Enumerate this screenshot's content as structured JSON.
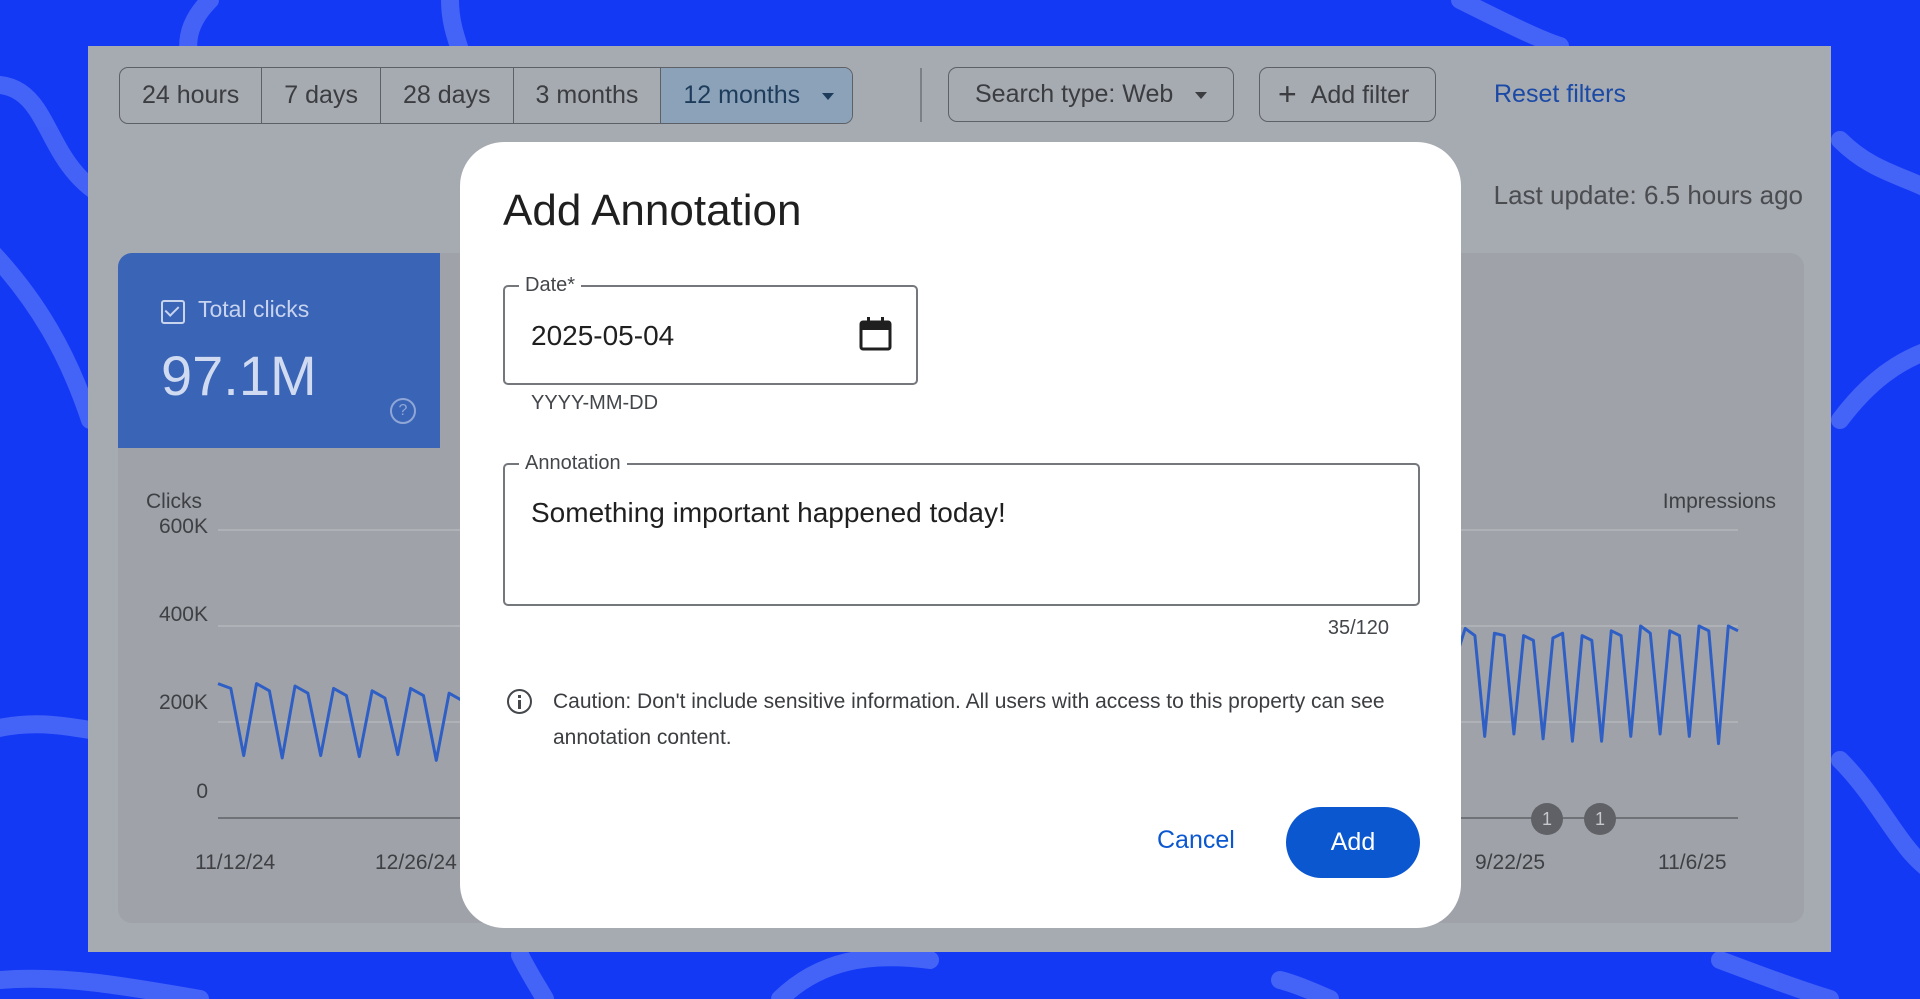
{
  "toolbar": {
    "ranges": [
      "24 hours",
      "7 days",
      "28 days",
      "3 months",
      "12 months"
    ],
    "active_range": "12 months",
    "search_type": "Search type: Web",
    "add_filter": "Add filter",
    "reset_filters": "Reset filters",
    "last_update": "Last update: 6.5 hours ago"
  },
  "metric": {
    "label": "Total clicks",
    "value": "97.1M",
    "help_icon": "help-circle-icon"
  },
  "chart_data": {
    "type": "line",
    "left_axis_label": "Clicks",
    "right_axis_label": "Impressions",
    "y_ticks": [
      "600K",
      "400K",
      "200K",
      "0"
    ],
    "ylim": [
      0,
      600000
    ],
    "x_ticks_visible": [
      "11/12/24",
      "12/26/24",
      "9/22/25",
      "11/6/25"
    ],
    "annotation_markers": [
      "1",
      "1"
    ],
    "series": [
      {
        "name": "Clicks",
        "color": "#2f5fc4",
        "segments": [
          {
            "x_range": [
              0,
              0.245
            ],
            "values": [
              280000,
              270000,
              130000,
              280000,
              265000,
              125000,
              275000,
              260000,
              130000,
              270000,
              255000,
              128000,
              265000,
              250000,
              132000,
              270000,
              255000,
              120000,
              260000,
              245000,
              115000,
              180000,
              140000,
              160000,
              110000,
              165000,
              120000,
              150000,
              110000,
              170000
            ]
          },
          {
            "x_range": [
              0.75,
              1.0
            ],
            "values": [
              250000,
              140000,
              260000,
              150000,
              270000,
              250000,
              140000,
              290000,
              300000,
              150000,
              330000,
              395000,
              380000,
              170000,
              385000,
              380000,
              175000,
              380000,
              370000,
              165000,
              375000,
              385000,
              160000,
              380000,
              370000,
              160000,
              390000,
              380000,
              170000,
              400000,
              385000,
              175000,
              390000,
              380000,
              170000,
              400000,
              390000,
              155000,
              400000,
              390000
            ]
          }
        ]
      }
    ]
  },
  "dialog": {
    "title": "Add Annotation",
    "date_label": "Date*",
    "date_value": "2025-05-04",
    "date_helper": "YYYY-MM-DD",
    "annotation_label": "Annotation",
    "annotation_value": "Something important happened today!",
    "counter": "35/120",
    "caution": "Caution: Don't include sensitive information. All users with access to this property can see annotation content.",
    "cancel": "Cancel",
    "add": "Add"
  },
  "colors": {
    "background": "#1339f5",
    "primary": "#0b57d0",
    "metric_card": "#3a64b6"
  }
}
